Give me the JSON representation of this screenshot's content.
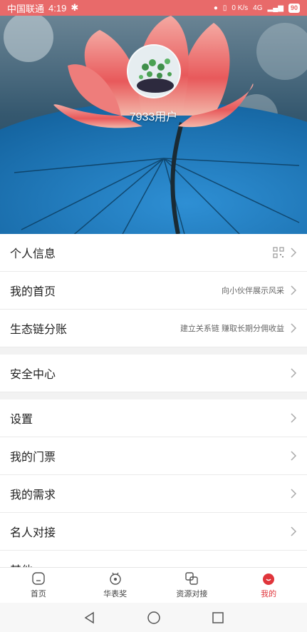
{
  "status_bar": {
    "carrier": "中国联通",
    "time": "4:19",
    "net_speed": "0 K/s",
    "signal": "4G",
    "battery": "90"
  },
  "profile": {
    "username": "7933用户"
  },
  "menu": {
    "personal_info": {
      "label": "个人信息"
    },
    "my_home": {
      "label": "我的首页",
      "hint": "向小伙伴展示风采"
    },
    "eco_chain": {
      "label": "生态链分账",
      "hint": "建立关系链 赚取长期分佣收益"
    },
    "security": {
      "label": "安全中心"
    },
    "settings": {
      "label": "设置"
    },
    "tickets": {
      "label": "我的门票"
    },
    "needs": {
      "label": "我的需求"
    },
    "celebrity": {
      "label": "名人对接"
    },
    "partial_label": "其他"
  },
  "tabbar": {
    "tabs": [
      {
        "label": "首页",
        "icon": "home-icon"
      },
      {
        "label": "华表奖",
        "icon": "award-icon"
      },
      {
        "label": "资源对接",
        "icon": "link-icon"
      },
      {
        "label": "我的",
        "icon": "profile-icon"
      }
    ],
    "active_color": "#e0353b"
  }
}
